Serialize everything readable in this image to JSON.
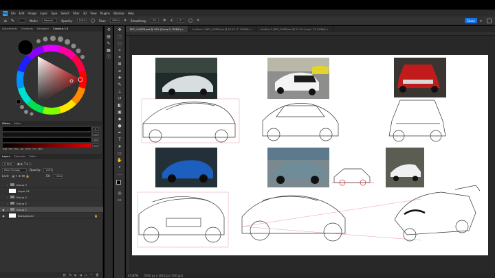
{
  "menubar": {
    "app_badge": "Ps",
    "items": [
      "File",
      "Edit",
      "Image",
      "Layer",
      "Type",
      "Select",
      "Filter",
      "3D",
      "View",
      "Plugins",
      "Window",
      "Help"
    ]
  },
  "options": {
    "mode_label": "Mode:",
    "mode_value": "Normal",
    "opacity_label": "Opacity:",
    "opacity_value": "100%",
    "flow_label": "Flow:",
    "flow_value": "100%",
    "smoothing_label": "Smoothing:",
    "smoothing_value": "0%",
    "angle_value": "0°",
    "share_label": "Share"
  },
  "left_tabs": [
    "Adjustments",
    "Gradients",
    "Navigator",
    "Coolorus 2.5"
  ],
  "left_tabs_active": 3,
  "sliders_tabs": [
    "Sliders",
    "Mixer"
  ],
  "slider_values": [
    "0",
    "100",
    "100",
    "100"
  ],
  "swatch_labels": [
    "RGB",
    "HSV",
    "HSL",
    "LAB",
    "CMYK",
    "YUV",
    "SEW"
  ],
  "layers_tabs": [
    "Layers",
    "Channels",
    "Paths"
  ],
  "layers": {
    "kind_label": "Q Kind",
    "blend_mode": "Pass Through",
    "opacity_label": "Opacity:",
    "opacity_value": "100%",
    "lock_label": "Lock:",
    "fill_label": "Fill:",
    "fill_value": "100%",
    "rows": [
      {
        "name": "Group 3",
        "type": "group",
        "visible": false
      },
      {
        "name": "Layer 16",
        "type": "layer",
        "visible": false
      },
      {
        "name": "Group 4",
        "type": "group",
        "visible": false
      },
      {
        "name": "Group 5",
        "type": "group",
        "visible": false
      },
      {
        "name": "Group 2",
        "type": "group",
        "visible": true
      },
      {
        "name": "Background",
        "type": "layer",
        "visible": true
      }
    ]
  },
  "doc_tabs": [
    "BEC_4 GHPR.psd @ 49% (Group 2, RGB/8)",
    "Untitled-1 (BEC_GHPR.psd @ 16.4% ©, RGB/8)",
    "Untitled-2 (BEC_GHPR.psd @ 27.4% (Layer 17, RGB/8)"
  ],
  "doc_tab_active": 0,
  "status": {
    "zoom": "47.87%",
    "dimensions": "5000 px x 2813 px (300 ppi)"
  },
  "colors": {
    "accent": "#1473e6",
    "foreground_swatch": "#000000",
    "background_swatch": "#ffffff",
    "canvas": "#ffffff",
    "panel": "#323232"
  }
}
